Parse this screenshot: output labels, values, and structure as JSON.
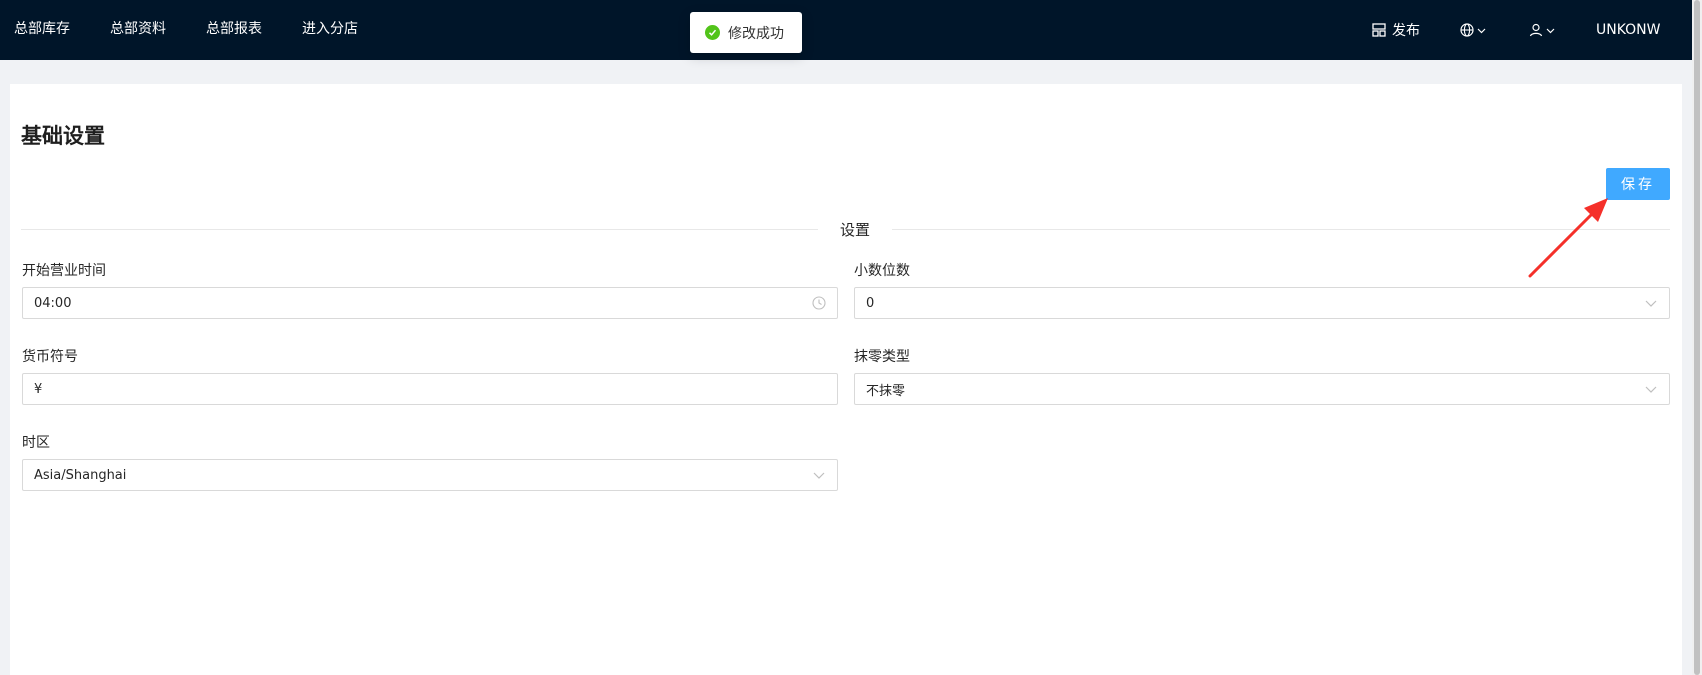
{
  "nav": {
    "items": [
      {
        "label": "总部库存"
      },
      {
        "label": "总部资料"
      },
      {
        "label": "总部报表"
      },
      {
        "label": "进入分店"
      }
    ]
  },
  "header_right": {
    "publish_label": "发布",
    "username": "UNKONW"
  },
  "toast": {
    "message": "修改成功",
    "status": "success",
    "color": "#52c41a"
  },
  "page": {
    "title": "基础设置",
    "save_label": "保存",
    "section_label": "设置"
  },
  "form": {
    "open_time": {
      "label": "开始营业时间",
      "value": "04:00",
      "icon": "clock-icon"
    },
    "decimals": {
      "label": "小数位数",
      "value": "0",
      "icon": "chevron-down-icon"
    },
    "currency": {
      "label": "货币符号",
      "value": "¥"
    },
    "rounding": {
      "label": "抹零类型",
      "value": "不抹零",
      "icon": "chevron-down-icon"
    },
    "timezone": {
      "label": "时区",
      "value": "Asia/Shanghai",
      "icon": "chevron-down-icon"
    }
  },
  "colors": {
    "header_bg": "#001529",
    "primary_button": "#40a9ff",
    "annotation_arrow": "#f5302a"
  }
}
